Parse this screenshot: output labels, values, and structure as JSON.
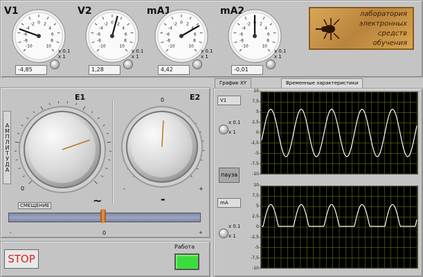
{
  "meters": [
    {
      "name": "V1",
      "value": "-4,85",
      "needle_deg": -70
    },
    {
      "name": "V2",
      "value": "1,28",
      "needle_deg": 15
    },
    {
      "name": "mA1",
      "value": "4,42",
      "needle_deg": 60
    },
    {
      "name": "mA2",
      "value": "-0,01",
      "needle_deg": 0
    }
  ],
  "meter_scale": [
    "-10",
    "-8",
    "-6",
    "-4",
    "-2",
    "0",
    "2",
    "4",
    "6",
    "8",
    "10"
  ],
  "range_labels": {
    "x01": "x 0.1",
    "x1": "x 1"
  },
  "logo": {
    "line1": "лаборатория",
    "line2": "электронных",
    "line3": "средств",
    "line4": "обучения"
  },
  "tabs": {
    "xy": "График XY",
    "time": "Временные характеристики"
  },
  "e1": {
    "label": "E1",
    "min": "0",
    "symbol": "~"
  },
  "e2": {
    "label": "E2",
    "top": "0",
    "minus": "-",
    "plus": "+",
    "symbol": "-"
  },
  "amplitude_label": "АМПЛИТУДА",
  "offset": {
    "label": "СМЕЩЕНИЕ",
    "left": "-",
    "center": "0",
    "right": "+"
  },
  "stop_label": "STOP",
  "work_label": "Работа",
  "pause_label": "пауза",
  "scope1": {
    "selector": "V1",
    "ticks": [
      "10-",
      "7,5-",
      "5-",
      "2,5-",
      "0-",
      "-2,5-",
      "-5-",
      "-7,5-",
      "-10-"
    ]
  },
  "scope2": {
    "selector": "mA",
    "ticks": [
      "10-",
      "7,5-",
      "5-",
      "2,5-",
      "0-",
      "-2,5-",
      "-5-",
      "-7,5-",
      "-10-"
    ]
  },
  "colors": {
    "led_on": "#3ddc3d",
    "trace": "#ffffff",
    "grid": "#7a8f1a",
    "stop_text": "#e02020"
  }
}
